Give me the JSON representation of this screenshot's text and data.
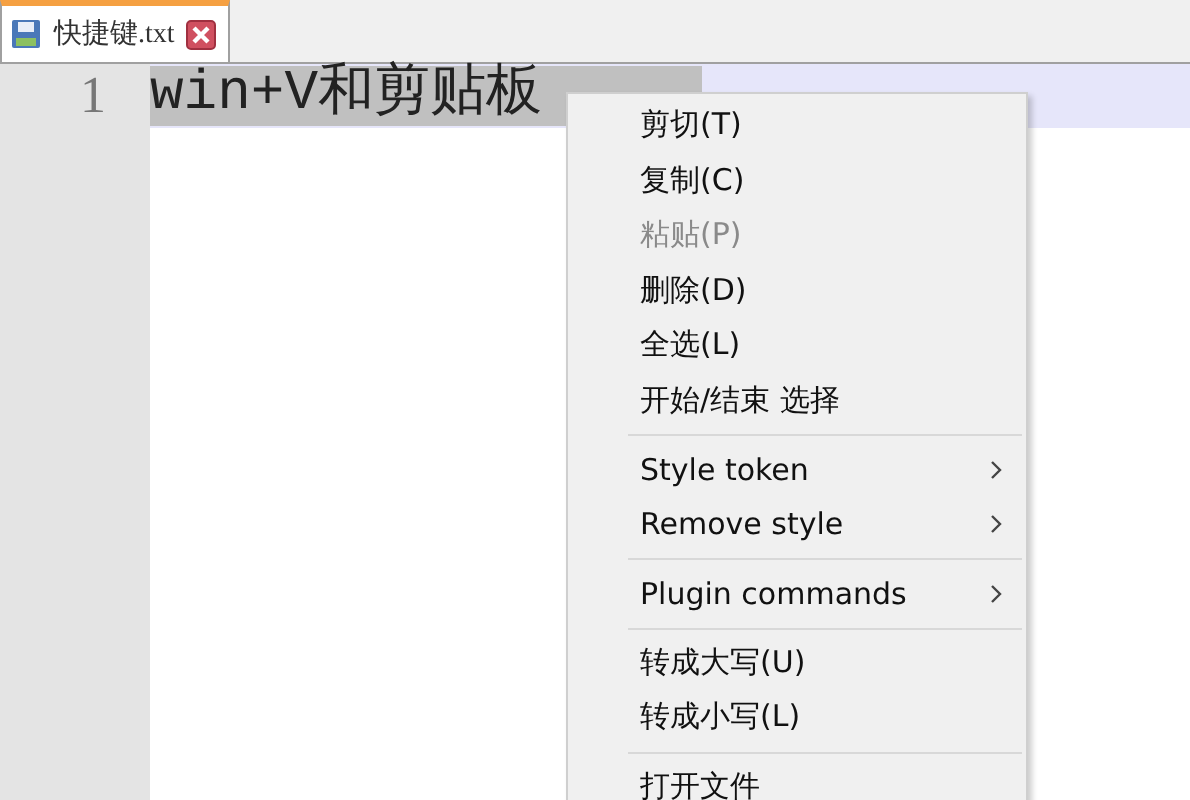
{
  "tabs": [
    {
      "label": "快捷键.txt",
      "selected": true
    }
  ],
  "editor": {
    "lines": [
      {
        "number": "1",
        "text": "win+V和剪贴板",
        "selected": true,
        "current": true
      }
    ]
  },
  "context_menu": {
    "groups": [
      {
        "items": [
          {
            "label": "剪切(T)",
            "disabled": false,
            "submenu": false
          },
          {
            "label": "复制(C)",
            "disabled": false,
            "submenu": false
          },
          {
            "label": "粘贴(P)",
            "disabled": true,
            "submenu": false
          },
          {
            "label": "删除(D)",
            "disabled": false,
            "submenu": false
          },
          {
            "label": "全选(L)",
            "disabled": false,
            "submenu": false
          },
          {
            "label": "开始/结束 选择",
            "disabled": false,
            "submenu": false
          }
        ]
      },
      {
        "items": [
          {
            "label": "Style token",
            "disabled": false,
            "submenu": true
          },
          {
            "label": "Remove style",
            "disabled": false,
            "submenu": true
          }
        ]
      },
      {
        "items": [
          {
            "label": "Plugin commands",
            "disabled": false,
            "submenu": true
          }
        ]
      },
      {
        "items": [
          {
            "label": "转成大写(U)",
            "disabled": false,
            "submenu": false
          },
          {
            "label": "转成小写(L)",
            "disabled": false,
            "submenu": false
          }
        ]
      },
      {
        "items": [
          {
            "label": "打开文件",
            "disabled": false,
            "submenu": false
          }
        ]
      }
    ]
  }
}
